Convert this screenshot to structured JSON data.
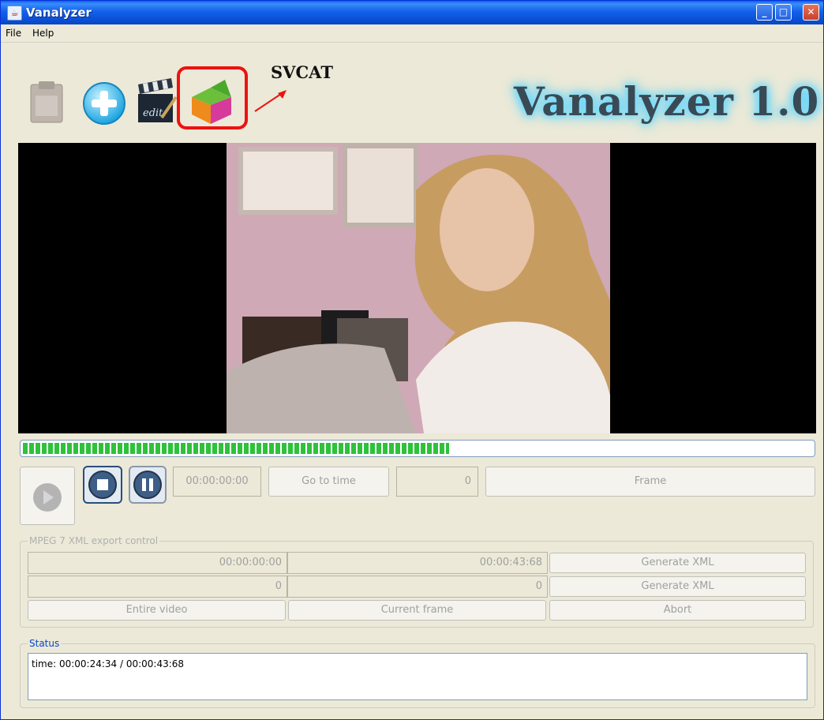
{
  "window": {
    "title": "Vanalyzer"
  },
  "menu": {
    "file": "File",
    "help": "Help"
  },
  "toolbar": {
    "icons": [
      "clipboard-icon",
      "add-icon",
      "clapperboard-edit-icon",
      "svcat-cube-icon"
    ],
    "clapper_text": "edit",
    "svcat_annotation": "SVCAT",
    "highlight_color": "#ee1111"
  },
  "logo": {
    "text": "Vanalyzer 1.0"
  },
  "player": {
    "progress_fraction": 0.54,
    "progress_color": "#2ec23a",
    "time_field": "00:00:00:00",
    "go_to_time_label": "Go to time",
    "frame_field": "0",
    "frame_label": "Frame"
  },
  "export": {
    "legend": "MPEG 7 XML export control",
    "row1": {
      "start": "00:00:00:00",
      "end": "00:00:43:68",
      "button": "Generate XML"
    },
    "row2": {
      "start": "0",
      "end": "0",
      "button": "Generate XML"
    },
    "entire_video": "Entire video",
    "current_frame": "Current frame",
    "abort": "Abort"
  },
  "status": {
    "legend": "Status",
    "text": "time: 00:00:24:34 / 00:00:43:68"
  }
}
